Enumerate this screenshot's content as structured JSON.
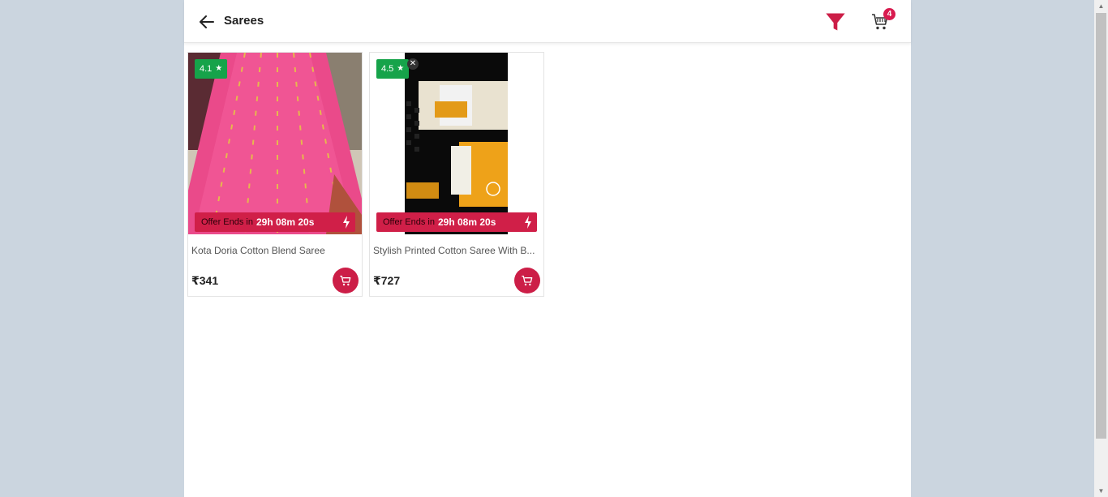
{
  "header": {
    "title": "Sarees",
    "cart_count": "4"
  },
  "products": [
    {
      "rating": "4.1",
      "offer_label": "Offer Ends in",
      "offer_time": "29h 08m 20s",
      "title": "Kota Doria Cotton Blend Saree",
      "price": "₹341"
    },
    {
      "rating": "4.5",
      "offer_label": "Offer Ends in",
      "offer_time": "29h 08m 20s",
      "title": "Stylish Printed Cotton Saree With B...",
      "price": "₹727"
    }
  ],
  "colors": {
    "accent": "#cc1e47",
    "rating_green": "#16a34a",
    "page_bg": "#cbd5df"
  }
}
